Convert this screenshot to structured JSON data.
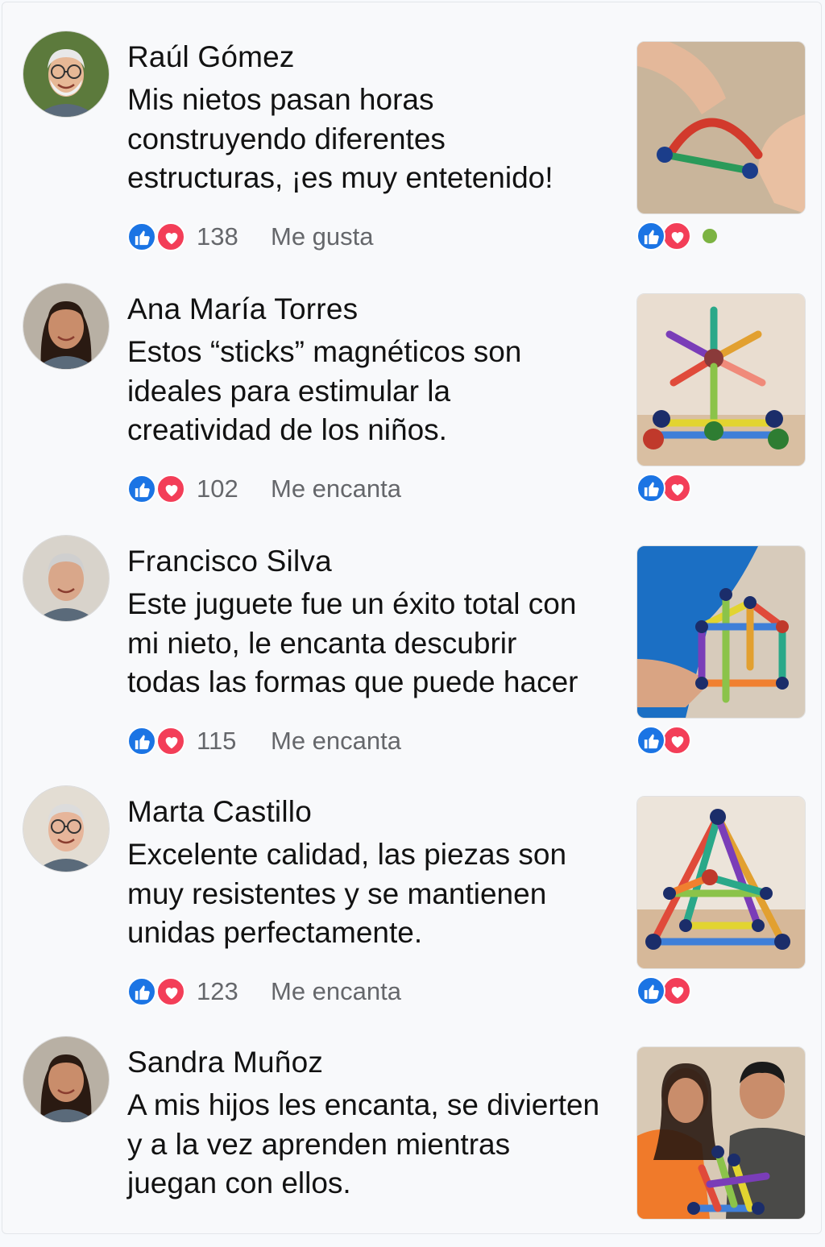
{
  "reviews": [
    {
      "name": "Raúl Gómez",
      "text": "Mis nietos pasan horas\nconstruyendo diferentes\nestructuras, ¡es muy entetenido!",
      "count": "138",
      "action": "Me gusta",
      "avatar": "older-man-white-beard-glasses",
      "photo": "hands-building-arch-with-magnetic-sticks",
      "show_online_dot": true
    },
    {
      "name": "Ana María Torres",
      "text": "Estos “sticks” magnéticos son\nideales para estimular la\ncreatividad de los niños.",
      "count": "102",
      "action": "Me encanta",
      "avatar": "smiling-woman-dark-hair",
      "photo": "magnetic-windmill-structure",
      "show_online_dot": false
    },
    {
      "name": "Francisco Silva",
      "text": "Este juguete fue un éxito total con\nmi nieto, le encanta descubrir\ntodas las formas que puede hacer",
      "count": "115",
      "action": "Me encanta",
      "avatar": "older-man-grey-hair",
      "photo": "child-building-cube-structure",
      "show_online_dot": false
    },
    {
      "name": "Marta Castillo",
      "text": "Excelente calidad, las piezas son\nmuy resistentes y se mantienen\nunidas perfectamente.",
      "count": "123",
      "action": "Me encanta",
      "avatar": "older-woman-glasses-white-hair",
      "photo": "magnetic-pyramid-structure",
      "show_online_dot": false
    },
    {
      "name": "Sandra Muñoz",
      "text": "A mis hijos les encanta, se divierten\ny a la vez aprenden mientras\njuegan con ellos.",
      "count": "",
      "action": "",
      "avatar": "smiling-woman-dark-hair",
      "photo": "couple-with-magnetic-tower",
      "show_online_dot": false
    }
  ],
  "colors": {
    "like": "#1b74e4",
    "love": "#f33e58",
    "secondary_text": "#65676b",
    "online": "#7cb342"
  },
  "icons": {
    "like": "thumbs-up-icon",
    "love": "heart-icon"
  }
}
